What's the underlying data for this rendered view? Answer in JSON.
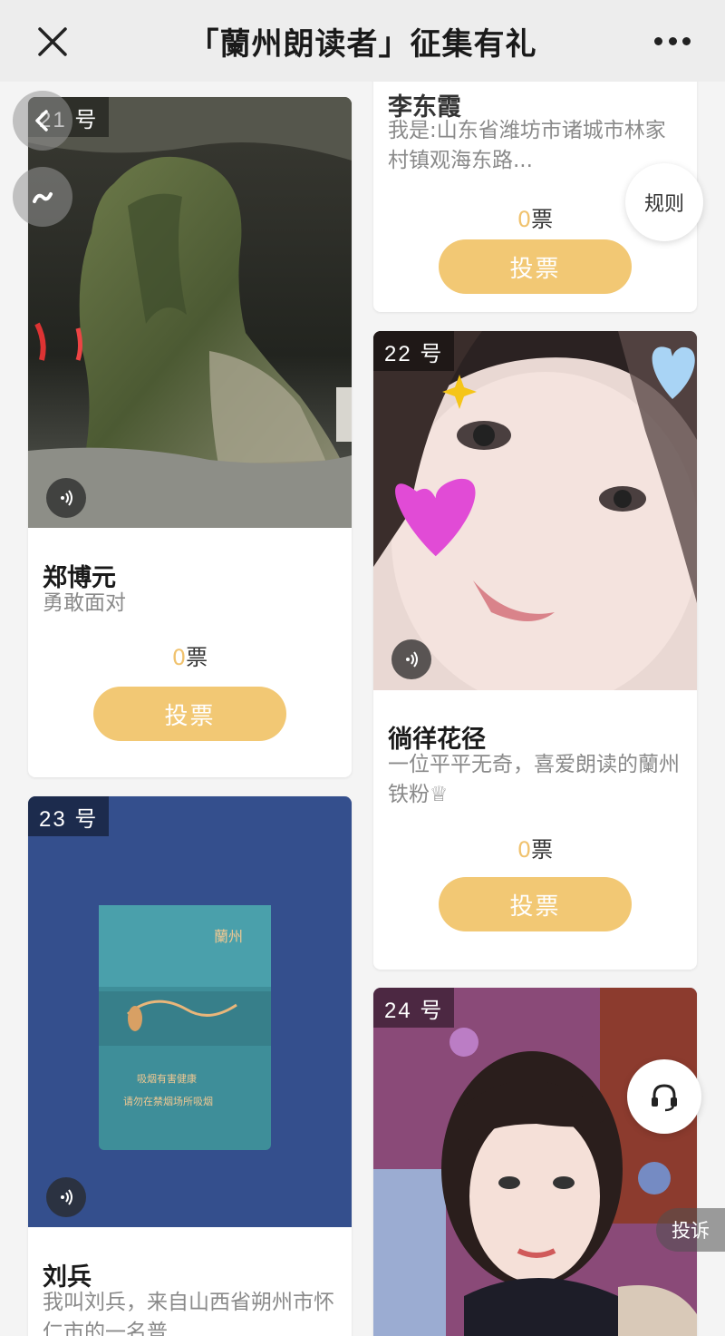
{
  "nav": {
    "title": "「蘭州朗读者」征集有礼"
  },
  "floating": {
    "rules_label": "规则",
    "report_label": "投诉"
  },
  "vote_unit": "票",
  "cards": {
    "c20": {
      "name": "李东霞",
      "desc": "我是:山东省潍坊市诸城市林家村镇观海东路...",
      "votes": "0",
      "vote_label": "投票"
    },
    "c21": {
      "number": "21 号",
      "name": "郑博元",
      "desc": "勇敢面对",
      "votes": "0",
      "vote_label": "投票"
    },
    "c22": {
      "number": "22 号",
      "name": "徜徉花径",
      "desc": "一位平平无奇，喜爱朗读的蘭州铁粉♕",
      "votes": "0",
      "vote_label": "投票"
    },
    "c23": {
      "number": "23 号",
      "name": "刘兵",
      "desc": "我叫刘兵，来自山西省朔州市怀仁市的一名普"
    },
    "c24": {
      "number": "24 号"
    }
  },
  "package_text": {
    "brand": "蘭州",
    "line1": "吸烟有害健康",
    "line2": "请勿在禁烟场所吸烟"
  }
}
